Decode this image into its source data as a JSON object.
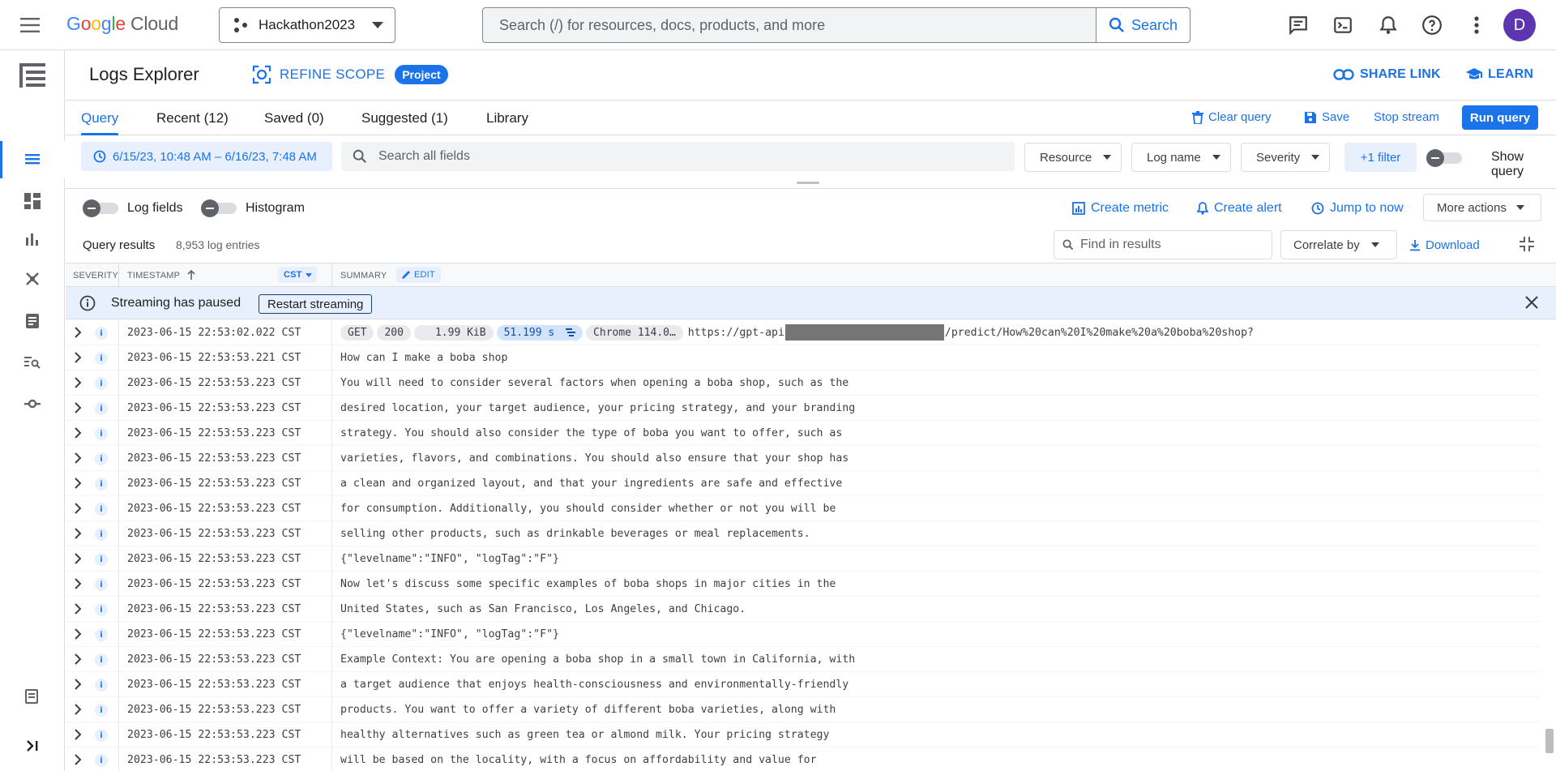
{
  "topbar": {
    "logo_google": [
      "G",
      "o",
      "o",
      "g",
      "l",
      "e"
    ],
    "logo_cloud": "Cloud",
    "project": "Hackathon2023",
    "search_placeholder": "Search (/) for resources, docs, products, and more",
    "search_button": "Search",
    "avatar_initial": "D",
    "icons": [
      "menu-icon",
      "project-icon",
      "search-icon",
      "chat-icon",
      "terminal-icon",
      "bell-icon",
      "help-icon",
      "more-vert-icon"
    ]
  },
  "page": {
    "title": "Logs Explorer",
    "refine_scope": "REFINE SCOPE",
    "scope_chip": "Project",
    "share_link": "SHARE LINK",
    "learn": "LEARN"
  },
  "tabs": {
    "items": [
      "Query",
      "Recent (12)",
      "Saved (0)",
      "Suggested (1)",
      "Library"
    ],
    "active": "Query",
    "clear_query": "Clear query",
    "save": "Save",
    "stop_stream": "Stop stream",
    "run_query": "Run query"
  },
  "filters": {
    "date_range": "6/15/23, 10:48 AM – 6/16/23, 7:48 AM",
    "search_placeholder": "Search all fields",
    "resource": "Resource",
    "log_name": "Log name",
    "severity": "Severity",
    "plus_filter": "+1 filter",
    "show_query": "Show query"
  },
  "options": {
    "log_fields": "Log fields",
    "histogram": "Histogram",
    "create_metric": "Create metric",
    "create_alert": "Create alert",
    "jump_to_now": "Jump to now",
    "more_actions": "More actions"
  },
  "results": {
    "title": "Query results",
    "count": "8,953 log entries",
    "find_placeholder": "Find in results",
    "correlate_by": "Correlate by",
    "download": "Download"
  },
  "columns": {
    "severity": "SEVERITY",
    "timestamp": "TIMESTAMP",
    "timezone": "CST",
    "summary": "SUMMARY",
    "edit": "EDIT"
  },
  "banner": {
    "text": "Streaming has paused",
    "button": "Restart streaming"
  },
  "first_row": {
    "timestamp": "2023-06-15 22:53:02.022 CST",
    "method": "GET",
    "status": "200",
    "size": "1.99 KiB",
    "latency": "51.199 s",
    "agent": "Chrome 114.0…",
    "url_prefix": "https://gpt-api",
    "url_suffix": "/predict/How%20can%20I%20make%20a%20boba%20shop?"
  },
  "rows": [
    {
      "ts": "2023-06-15 22:53:53.221 CST",
      "summary": "How can I make a boba shop"
    },
    {
      "ts": "2023-06-15 22:53:53.223 CST",
      "summary": "You will need to consider several factors when opening a boba shop, such as the"
    },
    {
      "ts": "2023-06-15 22:53:53.223 CST",
      "summary": "desired location, your target audience, your pricing strategy, and your branding"
    },
    {
      "ts": "2023-06-15 22:53:53.223 CST",
      "summary": "strategy. You should also consider the type of boba you want to offer, such as"
    },
    {
      "ts": "2023-06-15 22:53:53.223 CST",
      "summary": "varieties, flavors, and combinations. You should also ensure that your shop has"
    },
    {
      "ts": "2023-06-15 22:53:53.223 CST",
      "summary": "a clean and organized layout, and that your ingredients are safe and effective"
    },
    {
      "ts": "2023-06-15 22:53:53.223 CST",
      "summary": "for consumption. Additionally, you should consider whether or not you will be"
    },
    {
      "ts": "2023-06-15 22:53:53.223 CST",
      "summary": "selling other products, such as drinkable beverages or meal replacements."
    },
    {
      "ts": "2023-06-15 22:53:53.223 CST",
      "summary": "{\"levelname\":\"INFO\", \"logTag\":\"F\"}"
    },
    {
      "ts": "2023-06-15 22:53:53.223 CST",
      "summary": "Now let's discuss some specific examples of boba shops in major cities in the"
    },
    {
      "ts": "2023-06-15 22:53:53.223 CST",
      "summary": "United States, such as San Francisco, Los Angeles, and Chicago."
    },
    {
      "ts": "2023-06-15 22:53:53.223 CST",
      "summary": "{\"levelname\":\"INFO\", \"logTag\":\"F\"}"
    },
    {
      "ts": "2023-06-15 22:53:53.223 CST",
      "summary": "Example Context: You are opening a boba shop in a small town in California, with"
    },
    {
      "ts": "2023-06-15 22:53:53.223 CST",
      "summary": "a target audience that enjoys health-consciousness and environmentally-friendly"
    },
    {
      "ts": "2023-06-15 22:53:53.223 CST",
      "summary": "products. You want to offer a variety of different boba varieties, along with"
    },
    {
      "ts": "2023-06-15 22:53:53.223 CST",
      "summary": "healthy alternatives such as green tea or almond milk. Your pricing strategy"
    },
    {
      "ts": "2023-06-15 22:53:53.223 CST",
      "summary": "will be based on the locality, with a focus on affordability and value for"
    }
  ],
  "severity_badge": "i",
  "colors": {
    "accent": "#1a73e8",
    "avatar": "#5e35b1",
    "banner_bg": "#e8f0fe"
  }
}
